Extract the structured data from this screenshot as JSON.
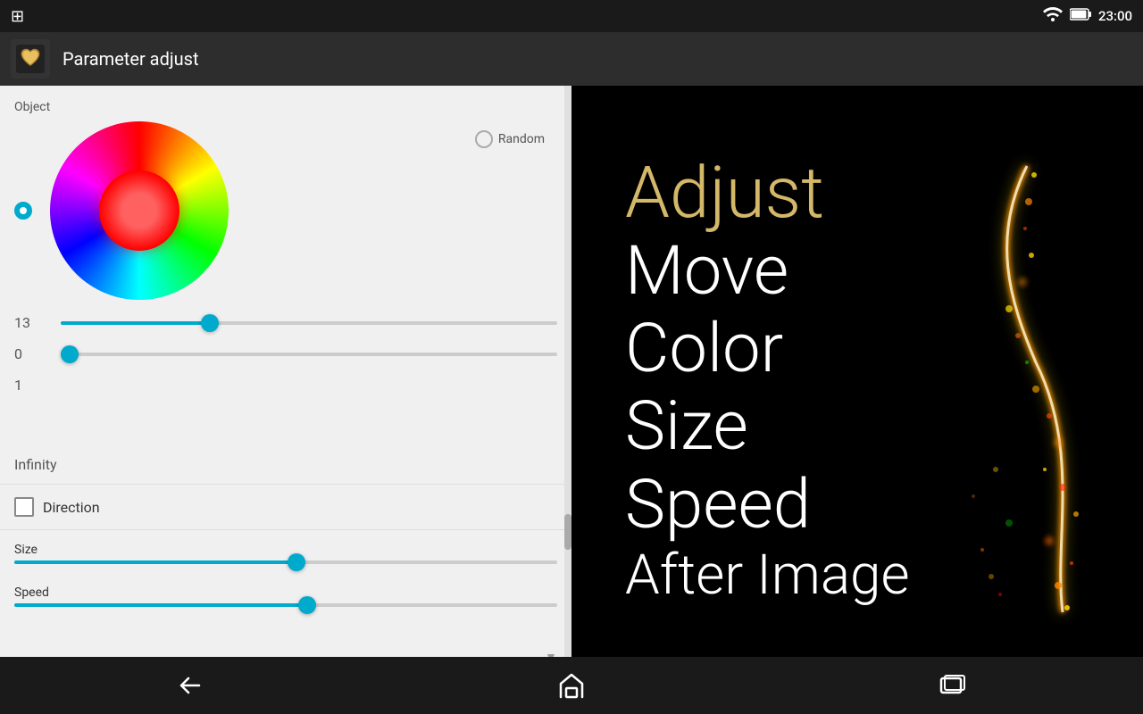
{
  "status_bar": {
    "time": "23:00",
    "wifi_icon": "wifi",
    "battery_icon": "battery"
  },
  "top_bar": {
    "title": "Parameter adjust"
  },
  "left_panel": {
    "object_label": "Object",
    "value_13": "13",
    "value_0": "0",
    "value_1": "1",
    "random_label": "Random",
    "infinity_label": "Infinity",
    "direction_label": "Direction",
    "size_label": "Size",
    "speed_label": "Speed",
    "slider_13_percent": 30,
    "slider_0_percent": 0,
    "size_slider_percent": 52,
    "speed_slider_percent": 54
  },
  "right_panel": {
    "words": [
      "Adjust",
      "Move",
      "Color",
      "Size",
      "Speed",
      "After Image"
    ]
  },
  "nav": {
    "back_label": "back",
    "home_label": "home",
    "recents_label": "recents"
  }
}
